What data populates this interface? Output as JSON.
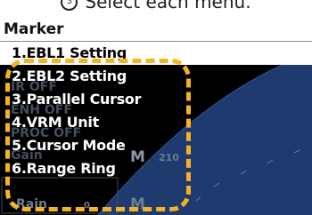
{
  "instruction": {
    "step_symbol": "3",
    "text": "Select each menu."
  },
  "menu": {
    "title": "Marker",
    "items": [
      {
        "label": "1.EBL1 Setting",
        "selected": true
      },
      {
        "label": "2.EBL2 Setting",
        "selected": false
      },
      {
        "label": "3.Parallel Cursor",
        "selected": false
      },
      {
        "label": "4.VRM Unit",
        "selected": false
      },
      {
        "label": "5.Cursor Mode",
        "selected": false
      },
      {
        "label": "6.Range Ring",
        "selected": false
      }
    ]
  },
  "background_labels": {
    "ir": "IR OFF",
    "enh": "ENH OFF",
    "proc": "PROC OFF",
    "gain": "Gain",
    "sea": "M",
    "bearing": "210",
    "rain": "Rain",
    "rain_value": "0",
    "rain_mode": "M"
  },
  "colors": {
    "highlight": "#ffffff",
    "background": "#000000",
    "callout": "#f5b324",
    "radar_sweep": "#1e3a6e"
  }
}
